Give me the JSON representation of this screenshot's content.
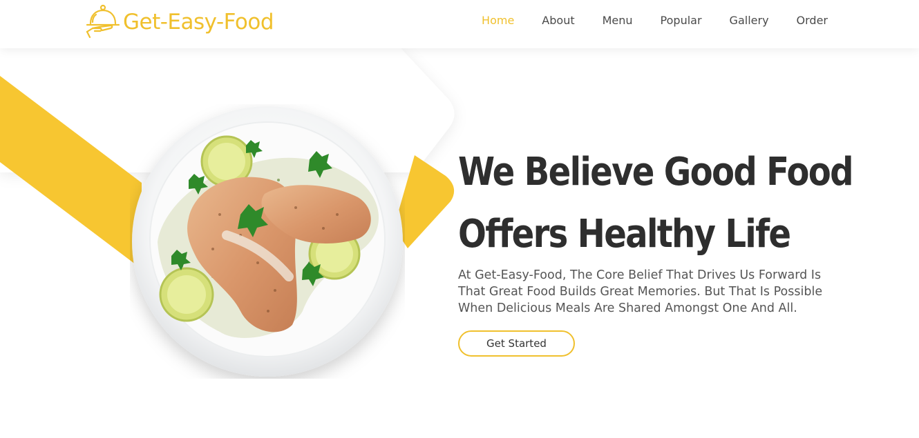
{
  "brand": {
    "name": "Get-Easy-Food",
    "logo_icon": "food-cloche-icon",
    "accent_color": "#f0c02d"
  },
  "nav": {
    "items": [
      {
        "label": "Home",
        "active": true
      },
      {
        "label": "About"
      },
      {
        "label": "Menu"
      },
      {
        "label": "Popular"
      },
      {
        "label": "Gallery"
      },
      {
        "label": "Order"
      }
    ]
  },
  "hero": {
    "headline_line1": "We Believe Good Food",
    "headline_line2": "Offers Healthy Life",
    "description": "At Get-Easy-Food, The Core Belief That Drives Us Forward Is That Great Food Builds Great Memories. But That Is Possible When Delicious Meals Are Shared Amongst One And All.",
    "cta_label": "Get Started",
    "image": "grilled-chicken-plate"
  }
}
